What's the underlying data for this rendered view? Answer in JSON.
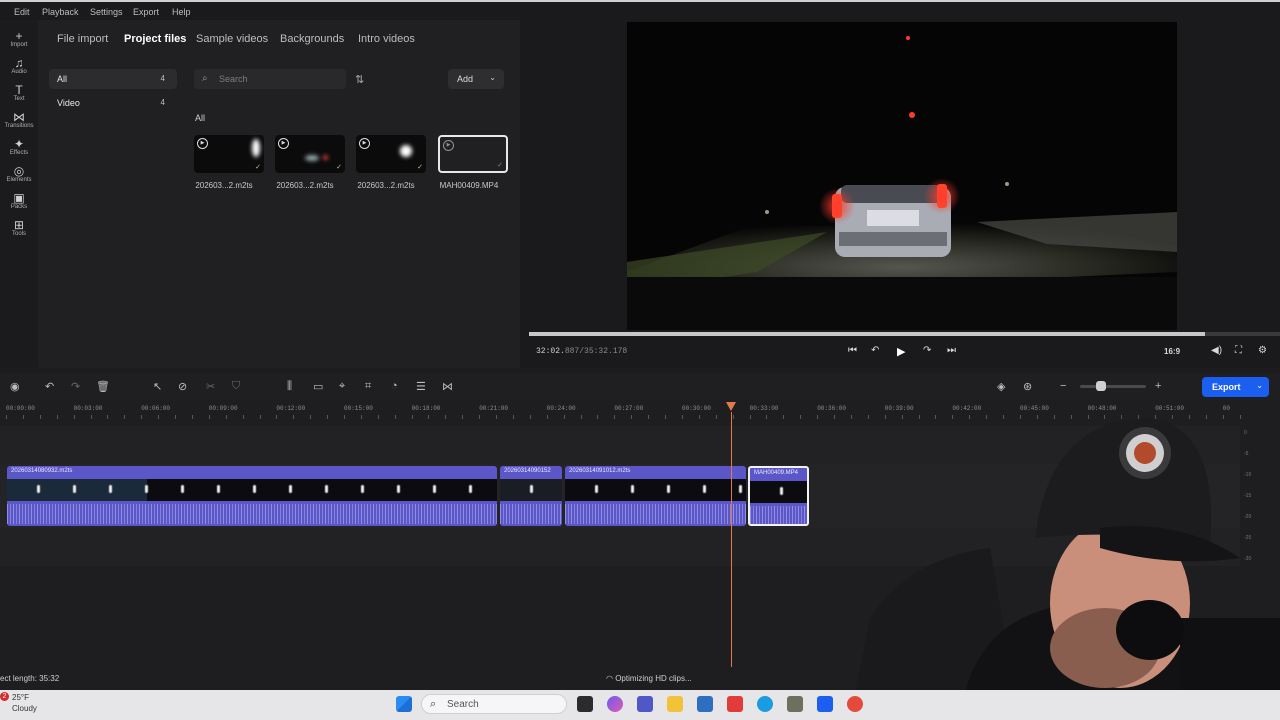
{
  "menu": [
    "Edit",
    "Playback",
    "Settings",
    "Export",
    "Help"
  ],
  "rail": [
    {
      "icon": "+",
      "label": "Import"
    },
    {
      "icon": "♫",
      "label": "Audio"
    },
    {
      "icon": "T",
      "label": "Text"
    },
    {
      "icon": "⋈",
      "label": "Transitions"
    },
    {
      "icon": "✦",
      "label": "Effects"
    },
    {
      "icon": "◎",
      "label": "Elements"
    },
    {
      "icon": "▣",
      "label": "Packs"
    },
    {
      "icon": "⊞",
      "label": "Tools"
    }
  ],
  "media": {
    "tabs": [
      "File import",
      "Project files",
      "Sample videos",
      "Backgrounds",
      "Intro videos"
    ],
    "active_tab": "Project files",
    "categories": [
      {
        "label": "All",
        "count": "4"
      },
      {
        "label": "Video",
        "count": "4"
      }
    ],
    "search_placeholder": "Search",
    "add_label": "Add",
    "section_heading": "All",
    "files": [
      "202603...2.m2ts",
      "202603...2.m2ts",
      "202603...2.m2ts",
      "MAH00409.MP4"
    ]
  },
  "preview": {
    "timecode_current": "32:02.",
    "timecode_rest": "887/35:32.178",
    "aspect_ratio": "16:9",
    "progress": 0.9
  },
  "timeline": {
    "ruler": [
      "00:00:00",
      "00:03:00",
      "00:06:00",
      "00:09:00",
      "00:12:00",
      "00:15:00",
      "00:18:00",
      "00:21:00",
      "00:24:00",
      "00:27:00",
      "00:30:00",
      "00:33:00",
      "00:36:00",
      "00:39:00",
      "00:42:00",
      "00:45:00",
      "00:48:00",
      "00:51:00",
      "00"
    ],
    "clips": [
      "20260314080932.m2ts",
      "20260314090152",
      "20260314091012.m2ts",
      "MAH00409.MP4"
    ],
    "meter_labels": [
      "0",
      "-5",
      "-10",
      "-15",
      "-20",
      "-25",
      "-30"
    ]
  },
  "export_label": "Export",
  "status": {
    "left": "ect length: 35:32",
    "center": "Optimizing HD clips..."
  },
  "taskbar": {
    "weather_temp": "25°F",
    "weather_desc": "Cloudy",
    "badge": "2",
    "search_label": "Search"
  },
  "colors": {
    "accent": "#1a5ff0",
    "clip": "#5b57c9",
    "playhead": "#e07a4a"
  }
}
